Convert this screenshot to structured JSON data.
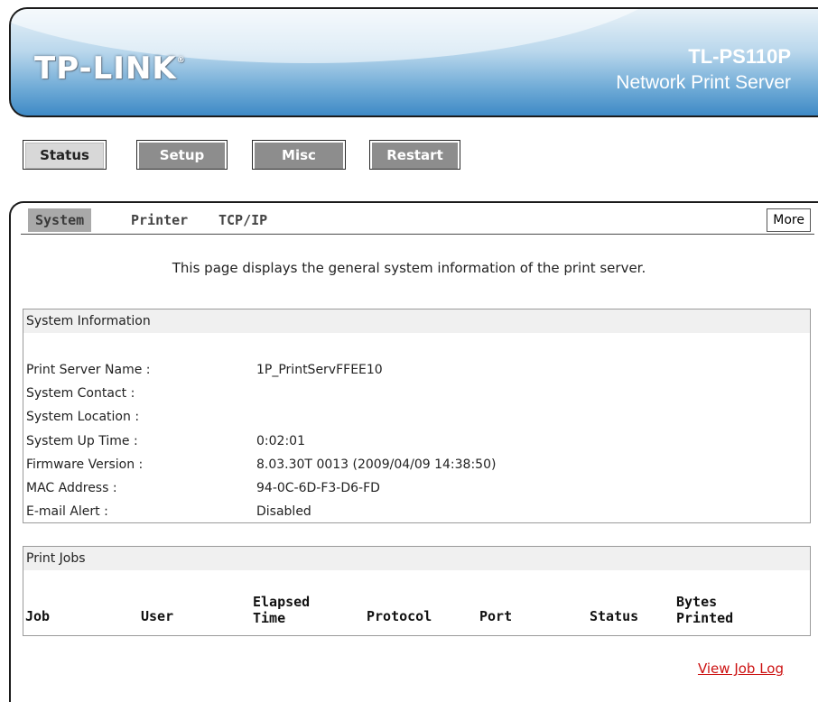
{
  "brand": {
    "logo": "TP-LINK",
    "reg_mark": "®",
    "model": "TL-PS110P",
    "product": "Network Print Server"
  },
  "topnav": [
    {
      "label": "Status",
      "active": true
    },
    {
      "label": "Setup",
      "active": false
    },
    {
      "label": "Misc",
      "active": false
    },
    {
      "label": "Restart",
      "active": false
    }
  ],
  "subnav": {
    "tabs": [
      "System",
      "Printer",
      "TCP/IP"
    ],
    "active": "System",
    "more_label": "More"
  },
  "description": "This page displays the general system information of the print server.",
  "system_info": {
    "title": "System Information",
    "rows": [
      {
        "label": "Print Server Name :",
        "value": "1P_PrintServFFEE10"
      },
      {
        "label": "System Contact :",
        "value": ""
      },
      {
        "label": "System Location :",
        "value": ""
      },
      {
        "label": "System Up Time :",
        "value": "0:02:01"
      },
      {
        "label": "Firmware Version :",
        "value": "8.03.30T 0013 (2009/04/09 14:38:50)"
      },
      {
        "label": "MAC Address :",
        "value": "94-0C-6D-F3-D6-FD"
      },
      {
        "label": "E-mail Alert :",
        "value": "Disabled"
      }
    ]
  },
  "print_jobs": {
    "title": "Print Jobs",
    "columns": [
      "Job",
      "User",
      "Elapsed Time",
      "Protocol",
      "Port",
      "Status",
      "Bytes Printed"
    ]
  },
  "view_log_label": "View Job Log",
  "colors": {
    "link": "#cc1111",
    "banner": "#3f8ac6",
    "tab_active": "#a9a9a9",
    "button_inactive": "#8d8d8d"
  }
}
